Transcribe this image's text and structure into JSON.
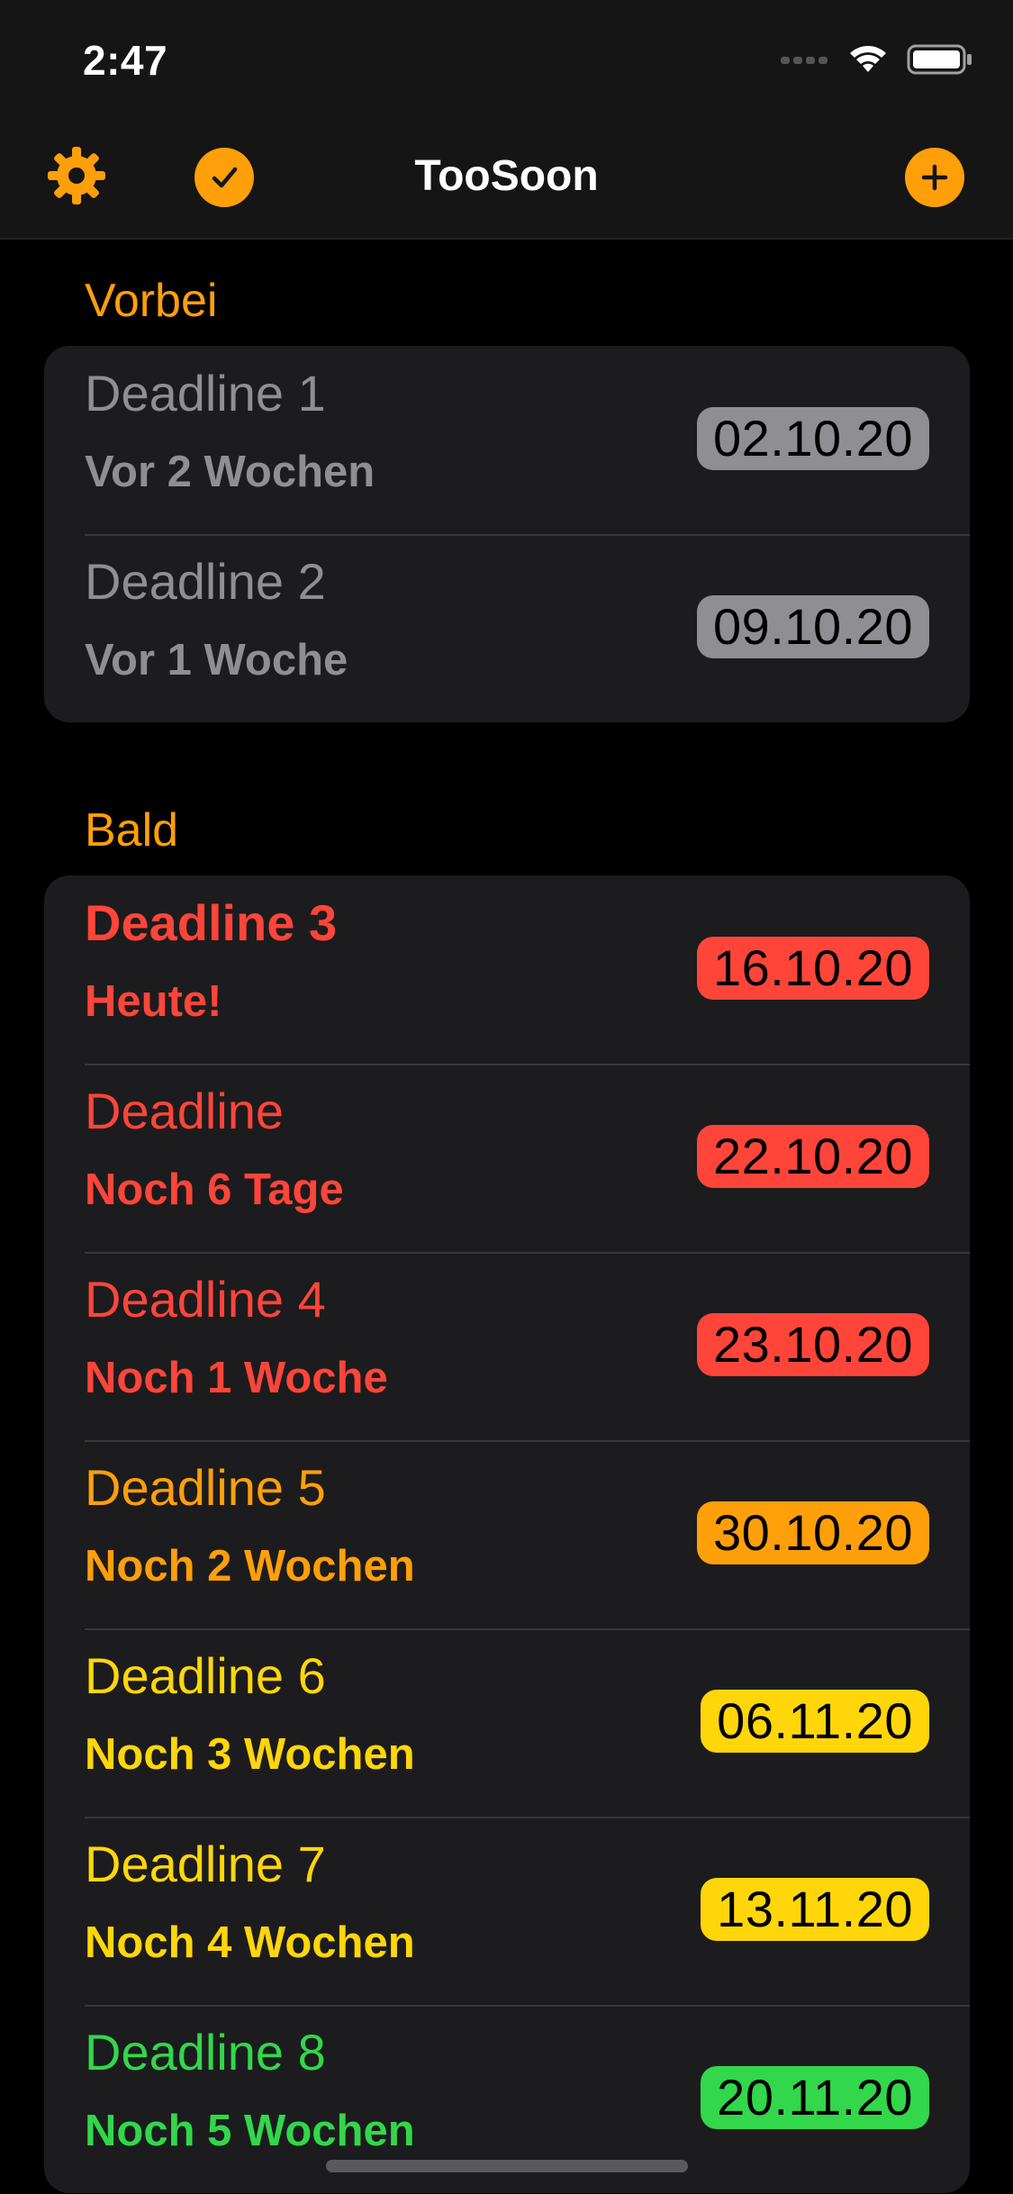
{
  "status_bar": {
    "time": "2:47",
    "icons": [
      "signal-icon",
      "wifi-icon",
      "battery-icon"
    ]
  },
  "nav": {
    "title": "TooSoon",
    "left_icons": [
      "gear-icon",
      "checkmark-icon"
    ],
    "right_icon": "plus-icon",
    "accent": "#ff9f0a"
  },
  "sections": {
    "past": {
      "header": "Vorbei",
      "rows": [
        {
          "title": "Deadline 1",
          "subtitle": "Vor 2 Wochen",
          "date": "02.10.20",
          "color": "#8e8e93"
        },
        {
          "title": "Deadline 2",
          "subtitle": "Vor 1 Woche",
          "date": "09.10.20",
          "color": "#8e8e93"
        }
      ]
    },
    "soon": {
      "header": "Bald",
      "rows": [
        {
          "title": "Deadline 3",
          "subtitle": "Heute!",
          "date": "16.10.20",
          "color": "#ff453a"
        },
        {
          "title": "Deadline",
          "subtitle": "Noch 6 Tage",
          "date": "22.10.20",
          "color": "#ff453a"
        },
        {
          "title": "Deadline 4",
          "subtitle": "Noch 1 Woche",
          "date": "23.10.20",
          "color": "#ff453a"
        },
        {
          "title": "Deadline 5",
          "subtitle": "Noch 2 Wochen",
          "date": "30.10.20",
          "color": "#ff9f0a"
        },
        {
          "title": "Deadline 6",
          "subtitle": "Noch 3 Wochen",
          "date": "06.11.20",
          "color": "#ffd60a"
        },
        {
          "title": "Deadline 7",
          "subtitle": "Noch 4 Wochen",
          "date": "13.11.20",
          "color": "#ffd60a"
        },
        {
          "title": "Deadline 8",
          "subtitle": "Noch 5 Wochen",
          "date": "20.11.20",
          "color": "#32d74b"
        }
      ]
    }
  }
}
